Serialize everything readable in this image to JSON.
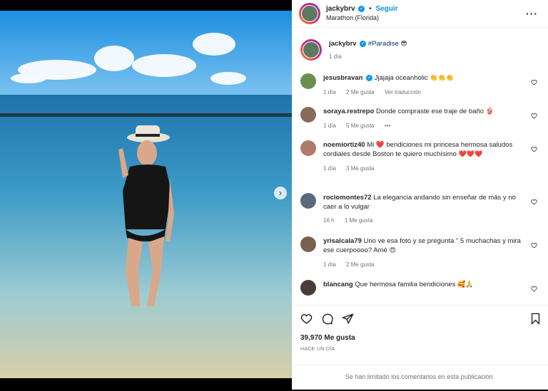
{
  "post": {
    "username": "jackybrv",
    "follow_label": "Seguir",
    "location": "Marathon (Florida)",
    "caption_hashtag": "#Paradise",
    "caption_emoji": "😎",
    "caption_time": "1 día",
    "likes": "39,970 Me gusta",
    "time_ago": "HACE UN DÍA",
    "comments_limited": "Se han limitado los comentarios en esta publicación."
  },
  "comments": [
    {
      "user": "jesusbravan",
      "verified": true,
      "text": "Jjajaja oceanholic",
      "emoji": "👏👏👏",
      "time": "1 día",
      "likes": "2 Me gusta",
      "extra": "Ver traducción",
      "avatar_color": "#6a8f4e"
    },
    {
      "user": "soraya.restrepo",
      "verified": false,
      "text": "Donde compraste ese traje de baño",
      "emoji": "👙",
      "time": "1 día",
      "likes": "5 Me gusta",
      "extra": "•••",
      "avatar_color": "#8a6b5a"
    },
    {
      "user": "noemiortiz40",
      "verified": false,
      "text": "Mi ❤️ bendiciones mi princesa hermosa saludos cordiales desde Boston te quiero muchísimo",
      "emoji": "❤️❤️❤️",
      "time": "1 día",
      "likes": "3 Me gusta",
      "extra": "",
      "avatar_color": "#b07a6a"
    },
    {
      "user": "rociomontes72",
      "verified": false,
      "text": "La elegancia andando sin enseñar de más y no caer a lo vulgar",
      "emoji": "",
      "time": "16 h",
      "likes": "1 Me gusta",
      "extra": "",
      "avatar_color": "#5a6a7a"
    },
    {
      "user": "yrisalcala79",
      "verified": false,
      "text": "Uno ve esa foto y se pregunta \" 5 muchachas y mira ese cuerpoooo? Amé",
      "emoji": "😍",
      "time": "1 día",
      "likes": "2 Me gusta",
      "extra": "",
      "avatar_color": "#7a6050"
    },
    {
      "user": "blancang",
      "verified": false,
      "text": "Que hermosa familia bendiciones",
      "emoji": "🥰🙏",
      "time": "",
      "likes": "",
      "extra": "",
      "avatar_color": "#4a3a3a"
    }
  ],
  "icons": [
    "heart-icon",
    "comment-icon",
    "share-icon",
    "bookmark-icon",
    "more-icon",
    "chevron-right-icon"
  ],
  "colors": {
    "verified": "#0095f6",
    "follow": "#0095f6",
    "hashtag": "#00376b",
    "sea": "#1f7fb3",
    "sky": "#3a9be0"
  }
}
